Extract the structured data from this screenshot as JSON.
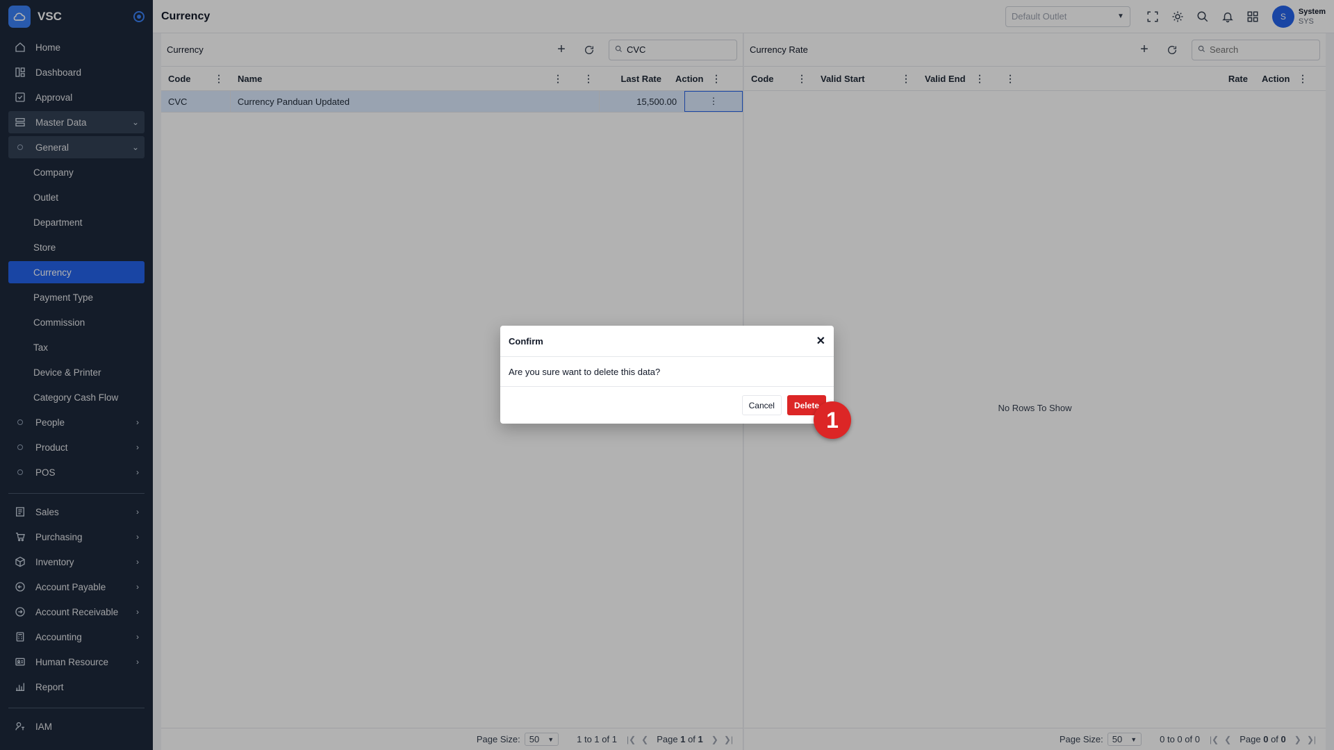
{
  "app": {
    "brand": "VSC",
    "page_title": "Currency"
  },
  "sidebar": {
    "top_items": [
      {
        "label": "Home",
        "icon": "home-icon"
      },
      {
        "label": "Dashboard",
        "icon": "dashboard-icon"
      },
      {
        "label": "Approval",
        "icon": "approval-icon"
      },
      {
        "label": "Master Data",
        "icon": "master-data-icon"
      }
    ],
    "general_label": "General",
    "general_items": [
      "Company",
      "Outlet",
      "Department",
      "Store",
      "Currency",
      "Payment Type",
      "Commission",
      "Tax",
      "Device & Printer",
      "Category Cash Flow"
    ],
    "groups": [
      "People",
      "Product",
      "POS"
    ],
    "modules": [
      {
        "label": "Sales",
        "icon": "sales-icon"
      },
      {
        "label": "Purchasing",
        "icon": "cart-icon"
      },
      {
        "label": "Inventory",
        "icon": "box-icon"
      },
      {
        "label": "Account Payable",
        "icon": "payable-icon"
      },
      {
        "label": "Account Receivable",
        "icon": "receivable-icon"
      },
      {
        "label": "Accounting",
        "icon": "calculator-icon"
      },
      {
        "label": "Human Resource",
        "icon": "id-card-icon"
      },
      {
        "label": "Report",
        "icon": "chart-icon"
      }
    ],
    "iam_label": "IAM"
  },
  "topbar": {
    "outlet_placeholder": "Default Outlet",
    "user_name": "System",
    "user_code": "SYS",
    "avatar_initial": "S"
  },
  "currency_panel": {
    "title": "Currency",
    "search_value": "CVC",
    "columns": {
      "code": "Code",
      "name": "Name",
      "last_rate": "Last Rate",
      "action": "Action"
    },
    "rows": [
      {
        "code": "CVC",
        "name": "Currency Panduan Updated",
        "last_rate": "15,500.00"
      }
    ],
    "footer": {
      "page_size_label": "Page Size:",
      "page_size": "50",
      "range": "1 to 1 of 1",
      "page_label": "Page",
      "page_current": "1",
      "of_label": "of",
      "page_total": "1"
    }
  },
  "rate_panel": {
    "title": "Currency Rate",
    "search_placeholder": "Search",
    "columns": {
      "code": "Code",
      "valid_start": "Valid Start",
      "valid_end": "Valid End",
      "rate": "Rate",
      "action": "Action"
    },
    "no_rows": "No Rows To Show",
    "footer": {
      "page_size_label": "Page Size:",
      "page_size": "50",
      "range": "0 to 0 of 0",
      "page_label": "Page",
      "page_current": "0",
      "of_label": "of",
      "page_total": "0"
    }
  },
  "dialog": {
    "title": "Confirm",
    "message": "Are you sure want to delete this data?",
    "cancel_label": "Cancel",
    "delete_label": "Delete"
  },
  "step_marker": "1",
  "colors": {
    "sidebar_bg": "#1e293b",
    "accent": "#2563eb",
    "danger": "#dc2626"
  }
}
